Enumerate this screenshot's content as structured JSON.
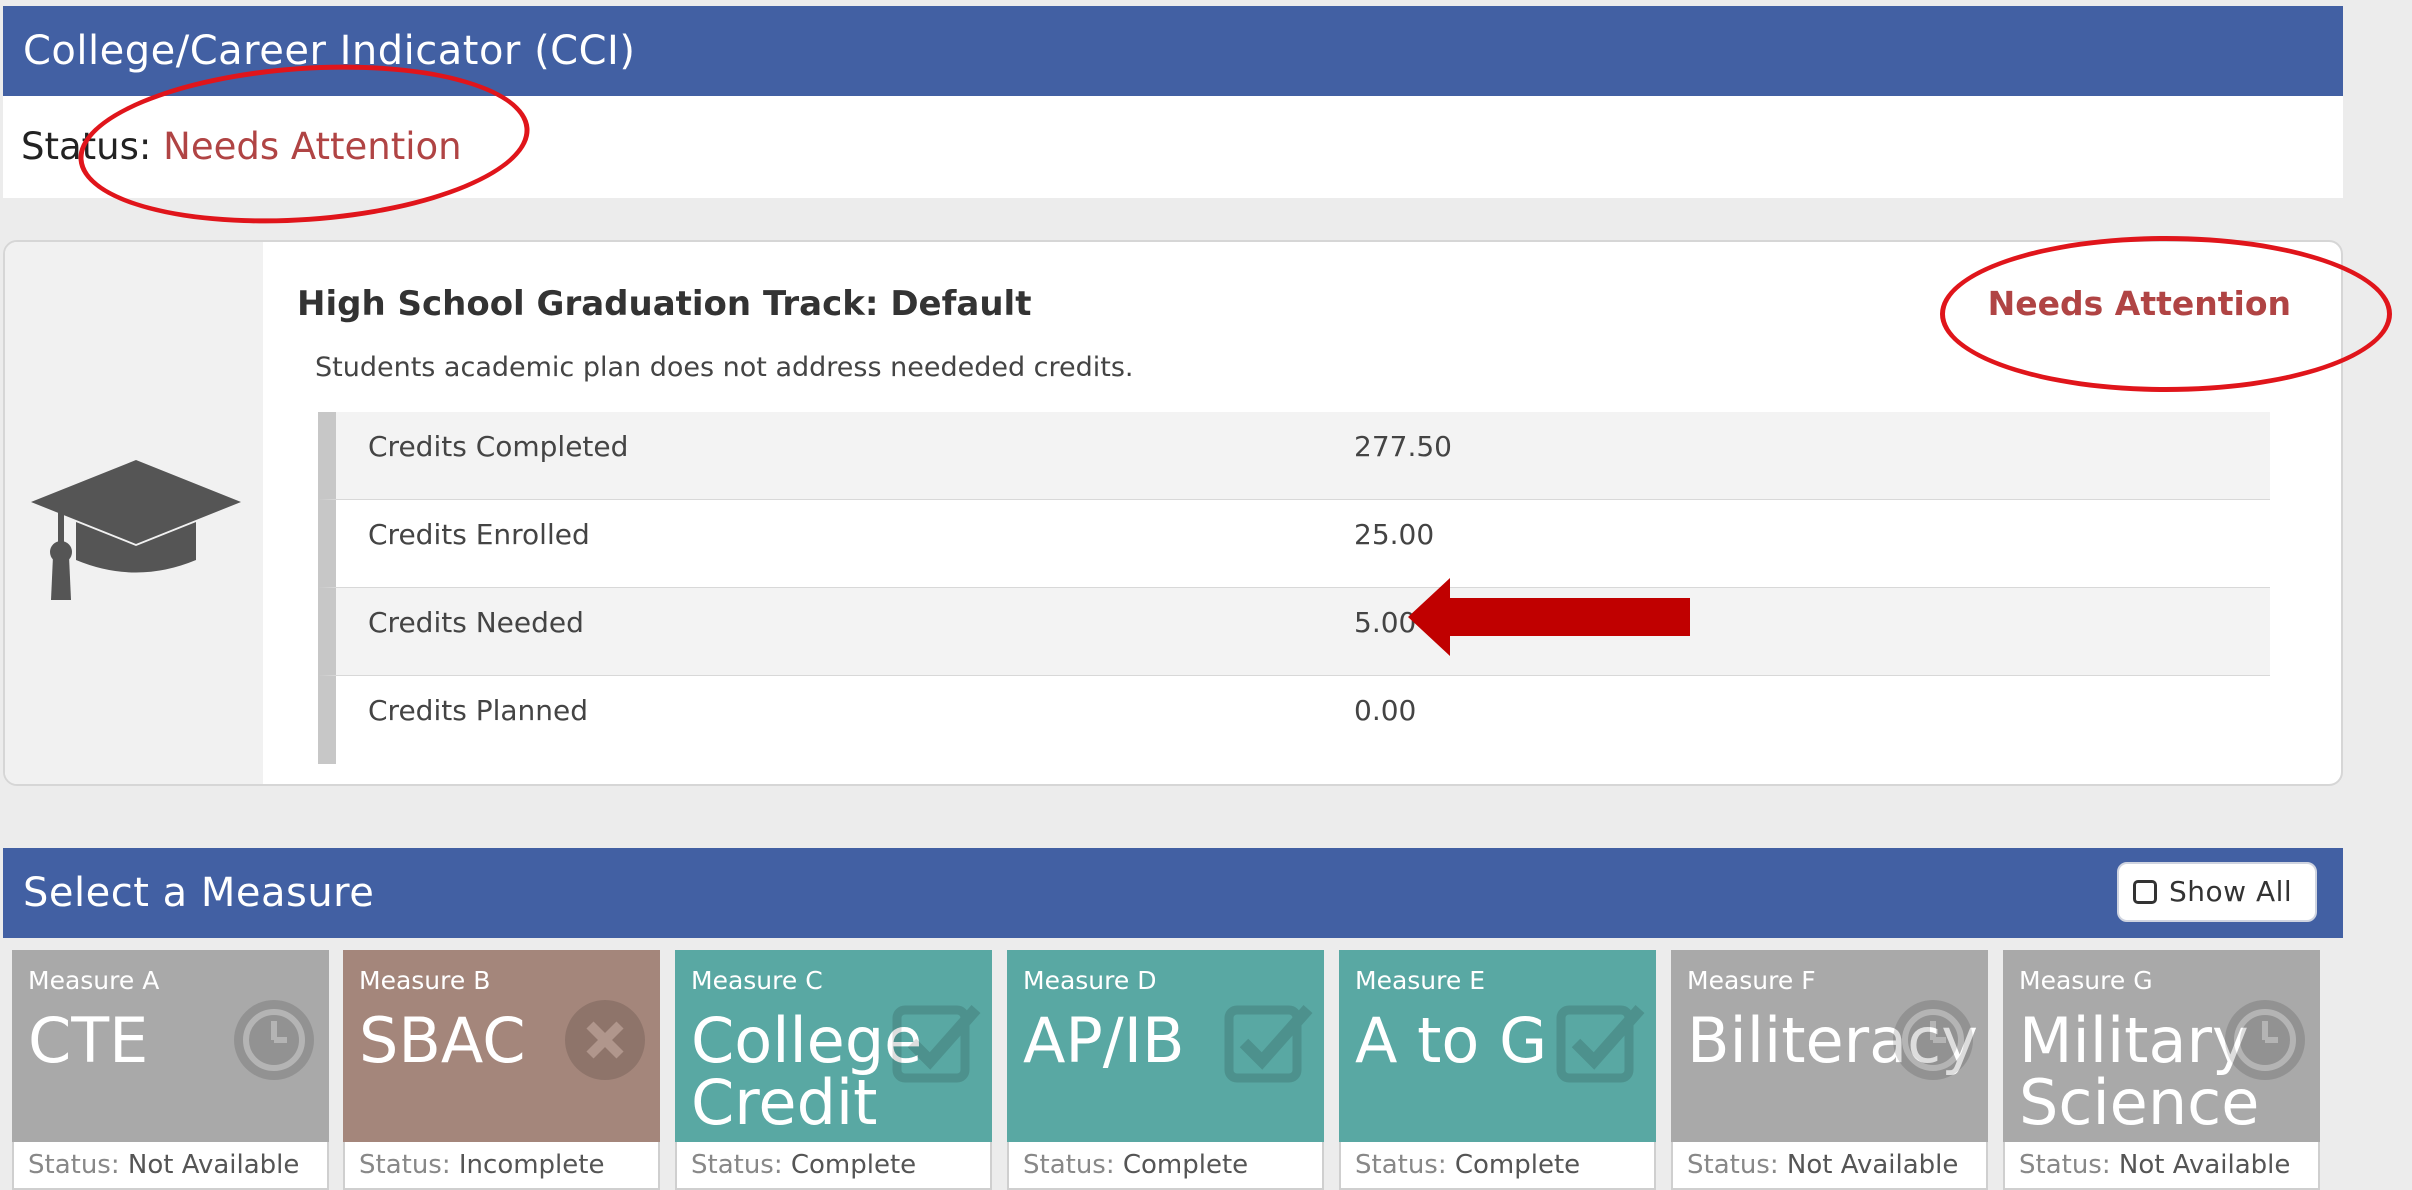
{
  "cci": {
    "title": "College/Career Indicator (CCI)",
    "status_label": "Status:",
    "status_value": "Needs Attention"
  },
  "track": {
    "title": "High School Graduation Track: Default",
    "status": "Needs Attention",
    "description": "Students academic plan does not address neededed credits.",
    "credits": [
      {
        "label": "Credits Completed",
        "value": "277.50"
      },
      {
        "label": "Credits Enrolled",
        "value": "25.00"
      },
      {
        "label": "Credits Needed",
        "value": "5.00"
      },
      {
        "label": "Credits Planned",
        "value": "0.00"
      }
    ]
  },
  "measures": {
    "title": "Select a Measure",
    "show_all_label": "Show All",
    "status_prefix": "Status:",
    "tiles": [
      {
        "label": "Measure A",
        "name_lines": [
          "CTE",
          ""
        ],
        "status": "Not Available",
        "icon": "clock-icon",
        "color": "#a9a9a9"
      },
      {
        "label": "Measure B",
        "name_lines": [
          "SBAC",
          ""
        ],
        "status": "Incomplete",
        "icon": "x-circle-icon",
        "color": "#a4867b"
      },
      {
        "label": "Measure C",
        "name_lines": [
          "College",
          "Credit"
        ],
        "status": "Complete",
        "icon": "checkbox-icon",
        "color": "#59a8a3"
      },
      {
        "label": "Measure D",
        "name_lines": [
          "AP/IB",
          ""
        ],
        "status": "Complete",
        "icon": "checkbox-icon",
        "color": "#59a8a3"
      },
      {
        "label": "Measure E",
        "name_lines": [
          "A to G",
          ""
        ],
        "status": "Complete",
        "icon": "checkbox-icon",
        "color": "#59a8a3"
      },
      {
        "label": "Measure F",
        "name_lines": [
          "Biliteracy",
          ""
        ],
        "status": "Not Available",
        "icon": "clock-icon",
        "color": "#a9a9a9"
      },
      {
        "label": "Measure G",
        "name_lines": [
          "Military",
          "Science"
        ],
        "status": "Not Available",
        "icon": "clock-icon",
        "color": "#a9a9a9"
      }
    ]
  },
  "colors": {
    "header_blue": "#4260a3",
    "attention_red": "#b04444",
    "annotation_red": "#e0151b",
    "arrow_red": "#c00000"
  }
}
